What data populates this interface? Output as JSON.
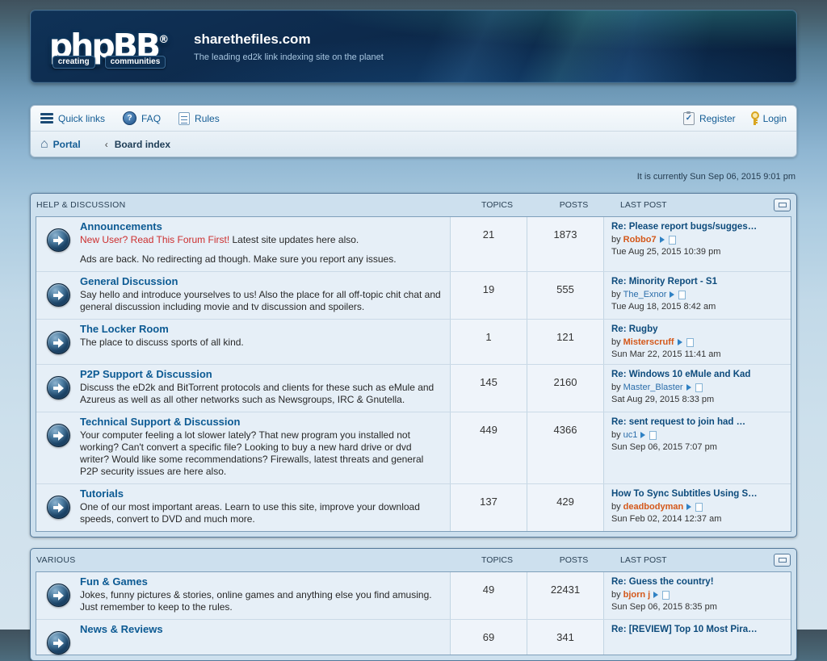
{
  "colors": {
    "accent_link": "#135c94",
    "forum_title": "#0c5a93",
    "lastpost_title": "#0d4b7c",
    "user_orange": "#d4581a",
    "user_blue": "#2a6daa",
    "alert_red": "#cc2e2e"
  },
  "header": {
    "logo_text": "phpBB",
    "logo_reg": "®",
    "tagline_left": "creating",
    "tagline_right": "communities",
    "site_title": "sharethefiles.com",
    "site_slogan": "The leading ed2k link indexing site on the planet"
  },
  "nav": {
    "quick_links": "Quick links",
    "faq": "FAQ",
    "faq_mark": "?",
    "rules": "Rules",
    "register": "Register",
    "register_check": "✓",
    "login": "Login",
    "portal": "Portal",
    "crumb_sep": "‹",
    "board_index": "Board index",
    "house_glyph": "⌂"
  },
  "current_time": "It is currently Sun Sep 06, 2015 9:01 pm",
  "columns": {
    "topics": "TOPICS",
    "posts": "POSTS",
    "last_post": "LAST POST"
  },
  "by_label": "by",
  "sections": [
    {
      "title": "HELP & DISCUSSION",
      "forums": [
        {
          "name": "Announcements",
          "desc_highlight": "New User? Read This Forum First!",
          "desc": " Latest site updates here also.",
          "desc2": "Ads are back. No redirecting ad though. Make sure you report any issues.",
          "topics": "21",
          "posts": "1873",
          "last": {
            "title": "Re: Please report bugs/sugges…",
            "user": "Robbo7",
            "user_style": "orange",
            "time": "Tue Aug 25, 2015 10:39 pm"
          }
        },
        {
          "name": "General Discussion",
          "desc": "Say hello and introduce yourselves to us! Also the place for all off-topic chit chat and general discussion including movie and tv discussion and spoilers.",
          "topics": "19",
          "posts": "555",
          "last": {
            "title": "Re: Minority Report - S1",
            "user": "The_Exnor",
            "user_style": "blue",
            "time": "Tue Aug 18, 2015 8:42 am"
          }
        },
        {
          "name": "The Locker Room",
          "desc": "The place to discuss sports of all kind.",
          "topics": "1",
          "posts": "121",
          "last": {
            "title": "Re: Rugby",
            "user": "Misterscruff",
            "user_style": "orange",
            "time": "Sun Mar 22, 2015 11:41 am"
          }
        },
        {
          "name": "P2P Support & Discussion",
          "desc": "Discuss the eD2k and BitTorrent protocols and clients for these such as eMule and Azureus as well as all other networks such as Newsgroups, IRC & Gnutella.",
          "topics": "145",
          "posts": "2160",
          "last": {
            "title": "Re: Windows 10 eMule and Kad",
            "user": "Master_Blaster",
            "user_style": "blue",
            "time": "Sat Aug 29, 2015 8:33 pm"
          }
        },
        {
          "name": "Technical Support & Discussion",
          "desc": "Your computer feeling a lot slower lately? That new program you installed not working? Can't convert a specific file? Looking to buy a new hard drive or dvd writer? Would like some recommendations? Firewalls, latest threats and general P2P security issues are here also.",
          "topics": "449",
          "posts": "4366",
          "last": {
            "title": "Re: sent request to join had …",
            "user": "uc1",
            "user_style": "blue",
            "time": "Sun Sep 06, 2015 7:07 pm"
          }
        },
        {
          "name": "Tutorials",
          "desc": "One of our most important areas. Learn to use this site, improve your download speeds, convert to DVD and much more.",
          "topics": "137",
          "posts": "429",
          "last": {
            "title": "How To Sync Subtitles Using S…",
            "user": "deadbodyman",
            "user_style": "orange",
            "time": "Sun Feb 02, 2014 12:37 am"
          }
        }
      ]
    },
    {
      "title": "VARIOUS",
      "forums": [
        {
          "name": "Fun & Games",
          "desc": "Jokes, funny pictures & stories, online games and anything else you find amusing. Just remember to keep to the rules.",
          "topics": "49",
          "posts": "22431",
          "last": {
            "title": "Re: Guess the country!",
            "user": "bjorn j",
            "user_style": "orange",
            "time": "Sun Sep 06, 2015 8:35 pm"
          }
        },
        {
          "name": "News & Reviews",
          "desc": "",
          "topics": "69",
          "posts": "341",
          "last": {
            "title": "Re: [REVIEW] Top 10 Most Pira…",
            "user": "",
            "user_style": "blue",
            "time": ""
          }
        }
      ]
    }
  ]
}
